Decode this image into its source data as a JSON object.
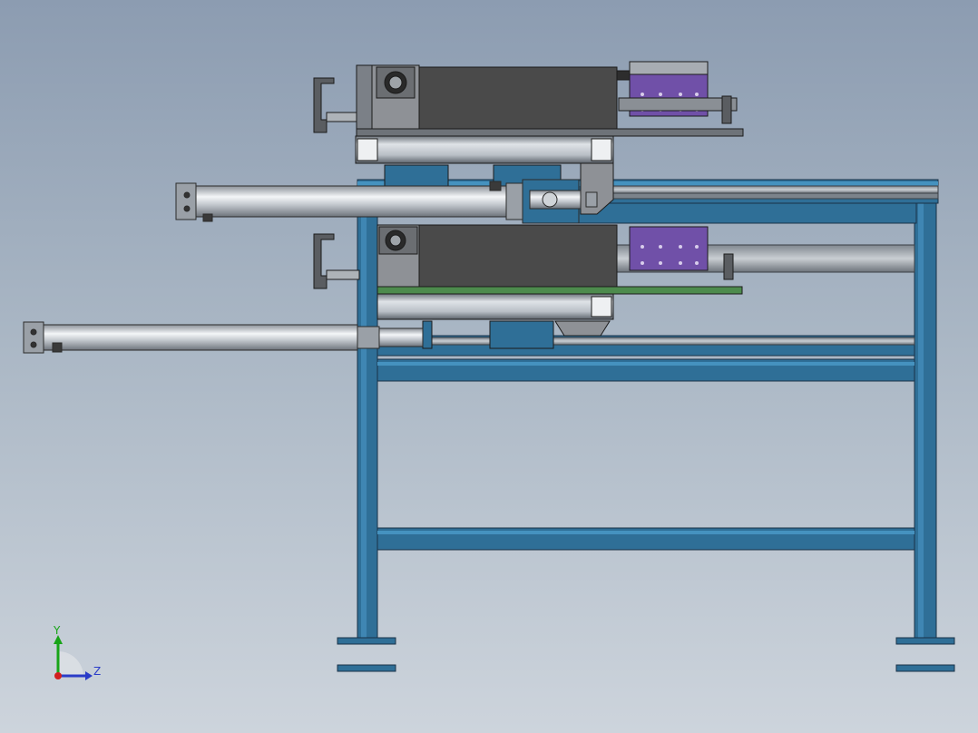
{
  "viewport": {
    "background_top": "#8c9cb1",
    "background_bottom": "#cdd4dc"
  },
  "colors": {
    "frame": "#2f6f97",
    "frame_edge": "#1a3247",
    "motor_body": "#4a4a4a",
    "motor_cap": "#8e9196",
    "slider_block": "#7050a8",
    "cylinder": "#c9cdd2",
    "rail": "#9aa1a8",
    "axis_x": "#d21f1f",
    "axis_y": "#18a418",
    "axis_z": "#2a3cc8"
  },
  "triad": {
    "y_label": "Y",
    "z_label": "Z",
    "icon": "coordinate-triad-icon"
  }
}
